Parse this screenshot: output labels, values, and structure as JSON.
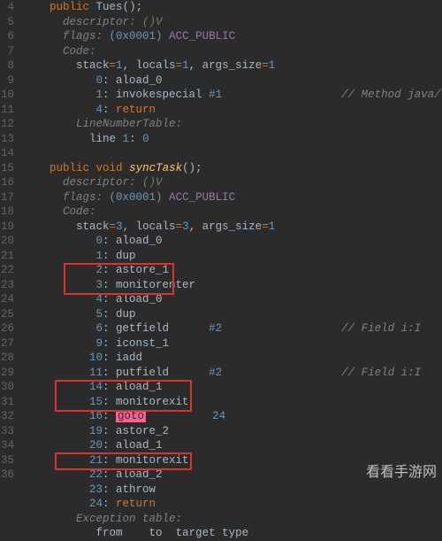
{
  "gutter": [
    "4",
    "5",
    "6",
    "7",
    "8",
    "9",
    "10",
    "11",
    "12",
    "13",
    "14",
    "15",
    "16",
    "17",
    "18",
    "19",
    "20",
    "21",
    "22",
    "23",
    "24",
    "25",
    "26",
    "27",
    "28",
    "29",
    "30",
    "31",
    "32",
    "33",
    "34",
    "35",
    "36"
  ],
  "ctor": {
    "sig_kw": "public",
    "sig_cls": "Tues",
    "sig_paren": "();",
    "desc_label": "descriptor:",
    "desc_val": "()V",
    "flags_label": "flags:",
    "flags_hex": "(0x0001)",
    "flags_name": "ACC_PUBLIC",
    "code_label": "Code:",
    "stack_line_a": "stack",
    "stack_line_b": "1",
    "stack_line_c": "locals",
    "stack_line_d": "1",
    "stack_line_e": "args_size",
    "stack_line_f": "1",
    "i0_idx": "0",
    "i0_op": "aload_0",
    "i1_idx": "1",
    "i1_op": "invokespecial",
    "i1_ref": "#1",
    "i1_cmt": "// Method java/lang/Obje",
    "i2_idx": "4",
    "i2_op": "return",
    "lnt_label": "LineNumberTable:",
    "lnt_a": "line",
    "lnt_b": "1",
    "lnt_c": "0"
  },
  "sync": {
    "sig_kw1": "public",
    "sig_kw2": "void",
    "sig_name": "syncTask",
    "sig_paren": "();",
    "desc_label": "descriptor:",
    "desc_val": "()V",
    "flags_label": "flags:",
    "flags_hex": "(0x0001)",
    "flags_name": "ACC_PUBLIC",
    "code_label": "Code:",
    "stack_a": "stack",
    "stack_b": "3",
    "stack_c": "locals",
    "stack_d": "3",
    "stack_e": "args_size",
    "stack_f": "1",
    "b0_i": "0",
    "b0_o": "aload_0",
    "b1_i": "1",
    "b1_o": "dup",
    "b2_i": "2",
    "b2_o": "astore_1",
    "b3_i": "3",
    "b3_o": "monitorenter",
    "b4_i": "4",
    "b4_o": "aload_0",
    "b5_i": "5",
    "b5_o": "dup",
    "b6_i": "6",
    "b6_o": "getfield",
    "b6_r": "#2",
    "b6_c": "// Field i:I",
    "b7_i": "9",
    "b7_o": "iconst_1",
    "b8_i": "10",
    "b8_o": "iadd",
    "b9_i": "11",
    "b9_o": "putfield",
    "b9_r": "#2",
    "b9_c": "// Field i:I",
    "b10_i": "14",
    "b10_o": "aload_1",
    "b11_i": "15",
    "b11_o": "monitorexit",
    "b12_i": "16",
    "b12_o": "goto",
    "b12_t": "24",
    "b13_i": "19",
    "b13_o": "astore_2",
    "b14_i": "20",
    "b14_o": "aload_1",
    "b15_i": "21",
    "b15_o": "monitorexit",
    "b16_i": "22",
    "b16_o": "aload_2",
    "b17_i": "23",
    "b17_o": "athrow",
    "b18_i": "24",
    "b18_o": "return",
    "exc_label": "Exception table:",
    "exc_h1": "from",
    "exc_h2": "to",
    "exc_h3": "target",
    "exc_h4": "type"
  },
  "watermark": "看看手游网"
}
